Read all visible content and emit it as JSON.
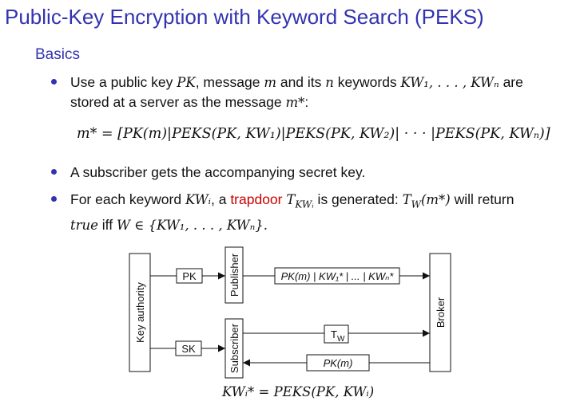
{
  "title": "Public-Key Encryption with Keyword Search (PEKS)",
  "subtitle": "Basics",
  "bullet1": {
    "p1": "Use a public key ",
    "pk": "PK",
    "p2": ", message ",
    "m": "m",
    "p3": " and its ",
    "n": "n",
    "p4": " keywords ",
    "kwlist": "KW₁, . . . , KWₙ",
    "p5": " are",
    "line2a": "stored at a server as the message ",
    "mstar": "m*",
    "line2b": ":"
  },
  "formula": "m* = [PK(m)|PEKS(PK, KW₁)|PEKS(PK, KW₂)| · · · |PEKS(PK, KWₙ)]",
  "bullet2": "A subscriber gets the accompanying secret key.",
  "bullet3": {
    "p1": "For each keyword ",
    "kwi": "KWᵢ",
    "p2": ", a ",
    "trapdoor": "trapdoor",
    "p3": " ",
    "tkw": "T",
    "tkw_sub": "KWᵢ",
    "p4": " is generated: ",
    "tw": "T",
    "tw_sub": "W",
    "tw_arg": "(m*)",
    "p5": " will return",
    "line2_true": "true",
    "line2_iff": " iff ",
    "line2_expr": "W ∈ {KW₁, . . . , KWₙ}."
  },
  "diagram": {
    "key_authority": "Key authority",
    "publisher": "Publisher",
    "subscriber": "Subscriber",
    "broker": "Broker",
    "pk_label": "PK",
    "sk_label": "SK",
    "msg_label": "PK(m) | KW₁* | ... | KWₙ*",
    "tw_label": "T",
    "tw_sub": "W",
    "pkm_label": "PK(m)"
  },
  "caption": "KWᵢ* = PEKS(PK, KWᵢ)"
}
